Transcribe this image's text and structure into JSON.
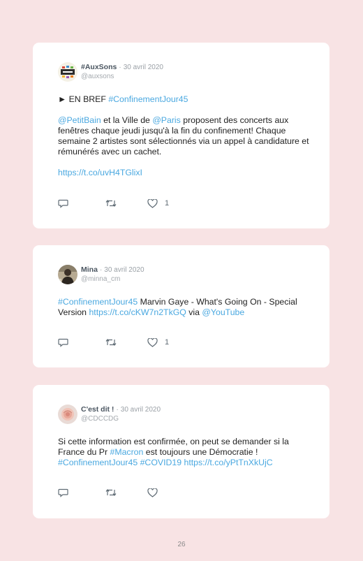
{
  "tweets": [
    {
      "name": "#AuxSons",
      "date": "30 avril 2020",
      "handle": "@auxsons",
      "avatar_icon": "auxsons-logo-icon",
      "line1_marker": "► EN BREF ",
      "line1_tag": "#ConfinementJour45",
      "p2_mention1": "@PetitBain",
      "p2_text1": " et la Ville de ",
      "p2_mention2": "@Paris",
      "p2_text2": " proposent des concerts aux fenêtres chaque jeudi jusqu'à la fin du confinement! Chaque semaine 2 artistes sont sélectionnés via un appel à candidature et rémunérés avec un cachet.",
      "url": "https://t.co/uvH4TGlixI",
      "likes": "1"
    },
    {
      "name": "Mina",
      "date": "30 avril 2020",
      "handle": "@minna_cm",
      "avatar_icon": "person-photo-icon",
      "tag": "#ConfinementJour45",
      "text1": " Marvin Gaye - What's Going On - Special Version ",
      "url": "https://t.co/cKW7n2TkGQ",
      "text2": " via ",
      "mention": "@YouTube",
      "likes": "1"
    },
    {
      "name": "C'est dit !",
      "date": "30 avril 2020",
      "handle": "@CDCCDG",
      "avatar_icon": "rose-photo-icon",
      "text1": "Si cette information est confirmée, on peut se demander si la France du Pr ",
      "tag1": "#Macron",
      "text2": " est toujours une Démocratie !",
      "tag2": "#ConfinementJour45",
      "tag3": "#COVID19",
      "url": "https://t.co/yPtTnXkUjC",
      "likes": ""
    }
  ],
  "page_number": "26",
  "colors": {
    "background": "#f8e3e4",
    "card": "#ffffff",
    "link": "#4aa8e0"
  }
}
